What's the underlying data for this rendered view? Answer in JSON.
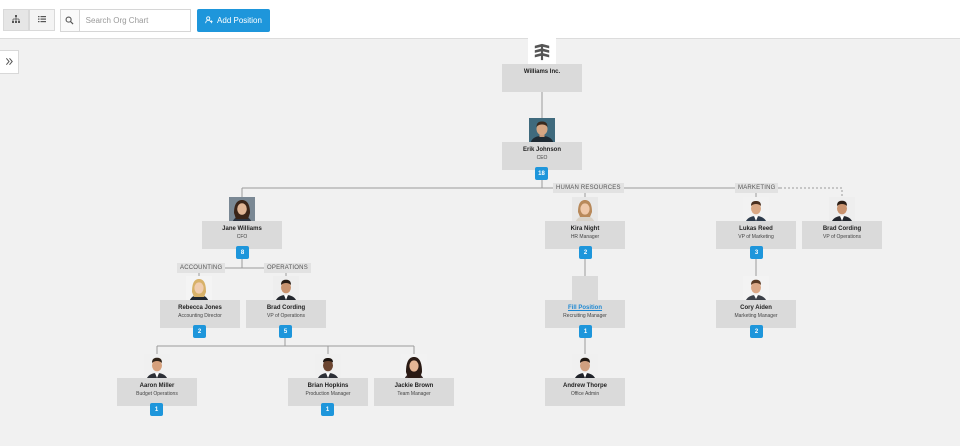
{
  "toolbar": {
    "search_placeholder": "Search Org Chart",
    "add_position_label": "Add Position",
    "chart_view_icon": "org-chart-icon",
    "list_view_icon": "list-icon"
  },
  "colors": {
    "accent": "#1e96db",
    "card": "#dadada",
    "background": "#f1f1f1"
  },
  "org": {
    "company": {
      "name": "Williams Inc."
    },
    "ceo": {
      "name": "Erik Johnson",
      "title": "CEO",
      "count": "18"
    },
    "departments": {
      "hr": "HUMAN RESOURCES",
      "marketing": "MARKETING",
      "accounting": "ACCOUNTING",
      "operations": "OPERATIONS"
    },
    "cfo": {
      "name": "Jane Williams",
      "title": "CFO",
      "count": "8"
    },
    "hr_manager": {
      "name": "Kira Night",
      "title": "HR Manager",
      "count": "2"
    },
    "vp_marketing": {
      "name": "Lukas Reed",
      "title": "VP of Marketing",
      "count": "3"
    },
    "vp_ops_assistant": {
      "name": "Brad Cording",
      "title": "VP of Operations"
    },
    "acct_director": {
      "name": "Rebecca Jones",
      "title": "Accounting Director",
      "count": "2"
    },
    "vp_operations": {
      "name": "Brad Cording",
      "title": "VP of Operations",
      "count": "5"
    },
    "recruiting": {
      "name": "Fill Position",
      "title": "Recruiting Manager",
      "count": "1"
    },
    "mkt_manager": {
      "name": "Cory Aiden",
      "title": "Marketing Manager",
      "count": "2"
    },
    "budget_ops": {
      "name": "Aaron Miller",
      "title": "Budget Operations",
      "count": "1"
    },
    "production": {
      "name": "Brian Hopkins",
      "title": "Production Manager",
      "count": "1"
    },
    "team_manager": {
      "name": "Jackie Brown",
      "title": "Team Manager"
    },
    "office_admin": {
      "name": "Andrew Thorpe",
      "title": "Office Admin"
    }
  }
}
